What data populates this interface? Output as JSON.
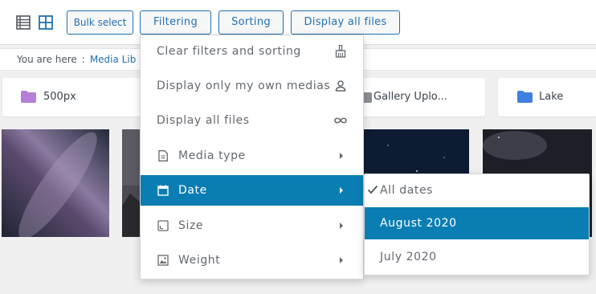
{
  "toolbar": {
    "list_view_icon": "list-view-icon",
    "grid_view_icon": "grid-view-icon",
    "bulk_select": "Bulk select",
    "filtering": "Filtering",
    "sorting": "Sorting",
    "display_all_files": "Display all files",
    "accent": "#2271b1"
  },
  "breadcrumb": {
    "prefix": "You are here",
    "separator": ":",
    "current": "Media Lib"
  },
  "folders": [
    {
      "label": "500px",
      "icon": "folder-icon",
      "color": "#b57fd8"
    },
    {
      "label": "Gallery Uplo...",
      "icon": "folder-icon",
      "color": "#8c8f94"
    },
    {
      "label": "Lake",
      "icon": "folder-icon",
      "color": "#3f7fe0"
    }
  ],
  "menu": {
    "items": [
      {
        "label": "Clear filters and sorting",
        "icon": "broom-icon"
      },
      {
        "label": "Display only my own medias",
        "icon": "user-icon"
      },
      {
        "label": "Display all files",
        "icon": "infinity-icon"
      },
      {
        "label": "Media type",
        "icon": "document-icon",
        "submenu": true
      },
      {
        "label": "Date",
        "icon": "calendar-icon",
        "submenu": true,
        "active": true
      },
      {
        "label": "Size",
        "icon": "resize-icon",
        "submenu": true
      },
      {
        "label": "Weight",
        "icon": "image-icon",
        "submenu": true
      }
    ],
    "active_color": "#0a7eb3"
  },
  "submenu": {
    "items": [
      {
        "label": "All dates",
        "checked": true
      },
      {
        "label": "August 2020",
        "active": true
      },
      {
        "label": "July 2020"
      }
    ]
  }
}
